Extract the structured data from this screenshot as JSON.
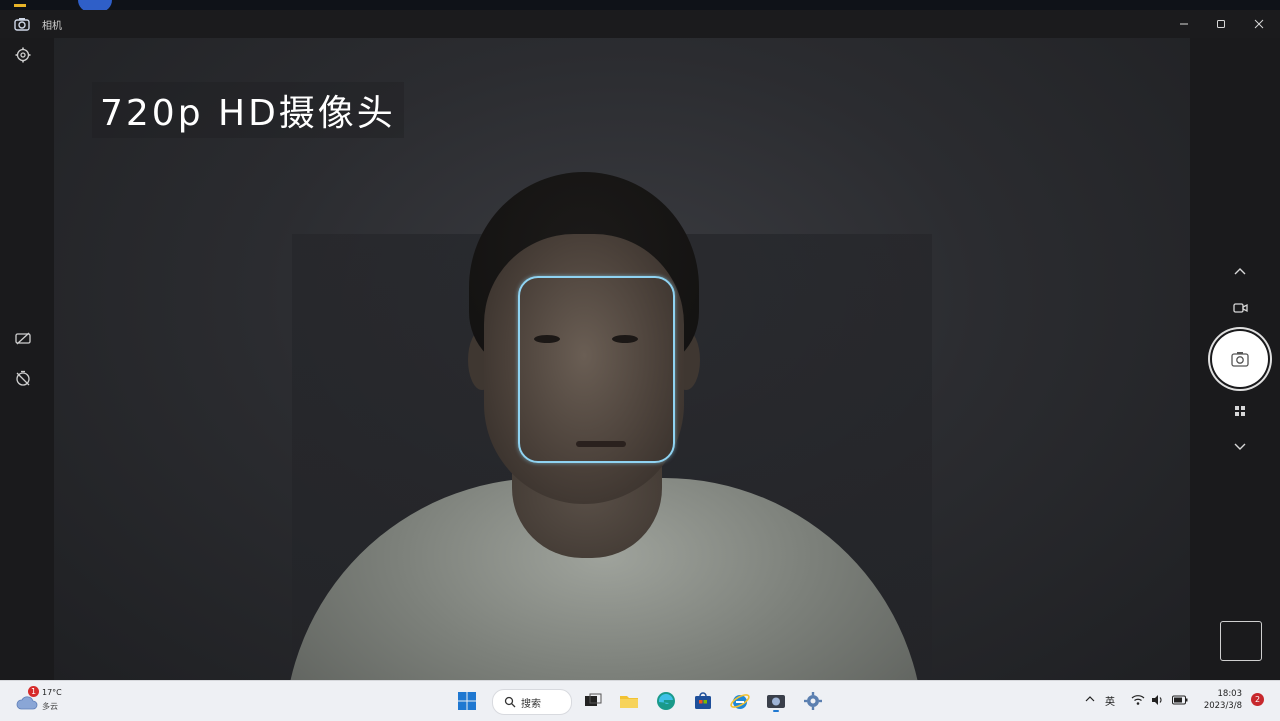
{
  "window": {
    "title": "相机",
    "caption": "720p HD摄像头"
  },
  "controls": {
    "minimize": "minimize",
    "maximize": "maximize",
    "close": "close"
  },
  "taskbar": {
    "weather": {
      "temp": "17°C",
      "condition": "多云",
      "badge": "1"
    },
    "search_label": "搜索",
    "tray": {
      "lang": "英"
    },
    "clock": {
      "time": "18:03",
      "date": "2023/3/8"
    },
    "notifications": "2"
  },
  "colors": {
    "face_box": "#8fd3f2",
    "taskbar_bg": "#eef0f4",
    "shutter": "#ffffff"
  }
}
